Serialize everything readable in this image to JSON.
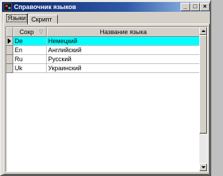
{
  "window": {
    "title": "Справочник языков",
    "minimize_label": "_",
    "maximize_label": "□",
    "close_label": "×"
  },
  "tabs": [
    {
      "label": "Языки",
      "active": true
    },
    {
      "label": "Скрипт",
      "active": false
    }
  ],
  "grid": {
    "columns": [
      {
        "label": "Сокр",
        "sort_icon": "▽"
      },
      {
        "label": "Название языка"
      }
    ],
    "rows": [
      {
        "code": "De",
        "name": "Немецкий",
        "selected": true
      },
      {
        "code": "En",
        "name": "Английский",
        "selected": false
      },
      {
        "code": "Ru",
        "name": "Русский",
        "selected": false
      },
      {
        "code": "Uk",
        "name": "Украинский",
        "selected": false
      }
    ],
    "selection_color": "#00ffff"
  },
  "scrollbar": {
    "visible_fraction": 0.77
  }
}
